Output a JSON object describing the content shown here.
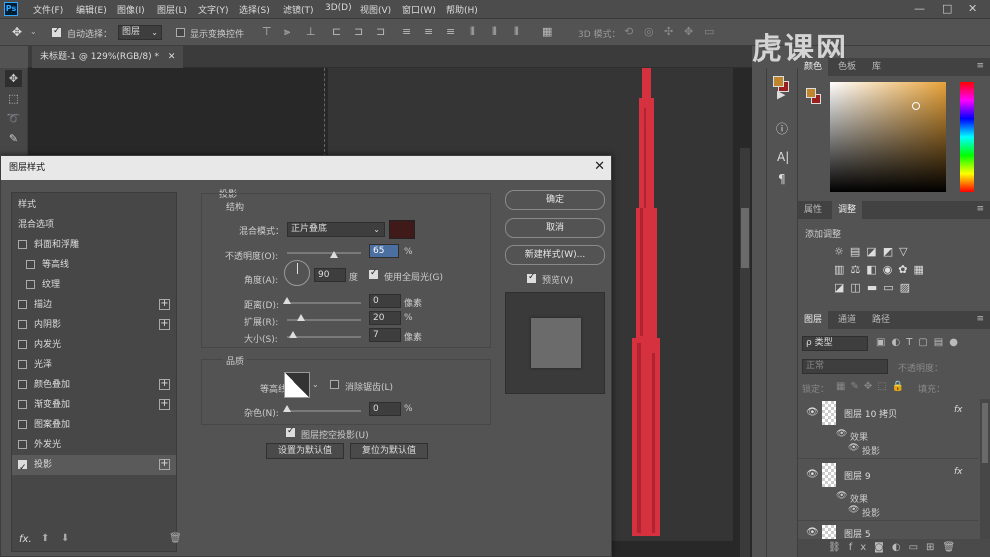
{
  "menubar": {
    "items": [
      "文件(F)",
      "编辑(E)",
      "图像(I)",
      "图层(L)",
      "文字(Y)",
      "选择(S)",
      "滤镜(T)",
      "3D(D)",
      "视图(V)",
      "窗口(W)",
      "帮助(H)"
    ],
    "ps_logo": "Ps"
  },
  "options": {
    "auto_select_label": "自动选择：",
    "auto_select_value": "图层",
    "show_transform_label": "显示变换控件",
    "mode3d_label": "3D 模式："
  },
  "document": {
    "tab_title": "未标题-1 @ 129%(RGB/8) *",
    "artwork_color": "#d6313f"
  },
  "color_panel": {
    "tabs": [
      "颜色",
      "色板",
      "库"
    ],
    "fg": "#c0862e",
    "bg": "#9a1f1f"
  },
  "adjust_panel": {
    "tabs": [
      "属性",
      "调整"
    ],
    "add_label": "添加调整"
  },
  "layers_panel": {
    "tabs": [
      "图层",
      "通道",
      "路径"
    ],
    "kind_filter": "ρ 类型",
    "blend": "正常",
    "opacity_label": "不透明度：",
    "lock_label": "锁定：",
    "fill_label": "填充：",
    "layers": [
      {
        "name": "图层 10 拷贝",
        "effects": "效果",
        "effect1": "投影",
        "fx": "fx"
      },
      {
        "name": "图层 9",
        "effects": "效果",
        "effect1": "投影",
        "fx": "fx"
      },
      {
        "name": "图层 5"
      }
    ]
  },
  "dialog": {
    "title": "图层样式",
    "styles": [
      {
        "label": "样式",
        "check": false,
        "plus": false,
        "nocheck": true
      },
      {
        "label": "混合选项",
        "check": false,
        "plus": false,
        "nocheck": true
      },
      {
        "label": "斜面和浮雕",
        "check": false,
        "plus": false
      },
      {
        "label": "等高线",
        "check": false,
        "plus": false,
        "indent": true
      },
      {
        "label": "纹理",
        "check": false,
        "plus": false,
        "indent": true
      },
      {
        "label": "描边",
        "check": false,
        "plus": true
      },
      {
        "label": "内阴影",
        "check": false,
        "plus": true
      },
      {
        "label": "内发光",
        "check": false,
        "plus": false
      },
      {
        "label": "光泽",
        "check": false,
        "plus": false
      },
      {
        "label": "颜色叠加",
        "check": false,
        "plus": true
      },
      {
        "label": "渐变叠加",
        "check": false,
        "plus": true
      },
      {
        "label": "图案叠加",
        "check": false,
        "plus": false
      },
      {
        "label": "外发光",
        "check": false,
        "plus": false
      },
      {
        "label": "投影",
        "check": true,
        "plus": true,
        "selected": true
      }
    ],
    "fx_label": "fx.",
    "section_title": "投影",
    "structure_title": "结构",
    "blend_mode_label": "混合模式：",
    "blend_mode_value": "正片叠底",
    "shadow_color": "#3f1a18",
    "opacity_label": "不透明度(O):",
    "opacity_value": "65",
    "opacity_unit": "%",
    "angle_label": "角度(A):",
    "angle_value": "90",
    "angle_unit": "度",
    "global_light_label": "使用全局光(G)",
    "distance_label": "距离(D):",
    "distance_value": "0",
    "distance_unit": "像素",
    "spread_label": "扩展(R):",
    "spread_value": "20",
    "spread_unit": "%",
    "size_label": "大小(S):",
    "size_value": "7",
    "size_unit": "像素",
    "quality_title": "品质",
    "contour_label": "等高线:",
    "antialias_label": "消除锯齿(L)",
    "noise_label": "杂色(N):",
    "noise_value": "0",
    "noise_unit": "%",
    "knockout_label": "图层挖空投影(U)",
    "set_default": "设置为默认值",
    "reset_default": "复位为默认值",
    "ok": "确定",
    "cancel": "取消",
    "new_style": "新建样式(W)...",
    "preview": "预览(V)"
  },
  "watermark": "虎课网"
}
